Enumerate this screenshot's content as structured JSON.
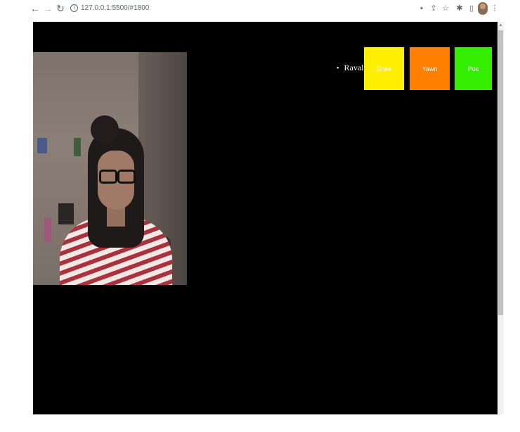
{
  "browser": {
    "url": "127.0.0.1:5500/#1800",
    "icons": [
      "back-icon",
      "forward-icon",
      "reload-icon",
      "info-icon",
      "screen-cast-icon",
      "share-icon",
      "star-icon",
      "extensions-icon",
      "sidebar-icon",
      "menu-icon"
    ]
  },
  "page": {
    "users": [
      "Ravali"
    ],
    "buttons": {
      "draw": {
        "label": "Draw",
        "color": "#ffee00"
      },
      "yawn": {
        "label": "Yawn",
        "color": "#ff7f00"
      },
      "pos": {
        "label": "Pos",
        "color": "#33ee00"
      }
    },
    "background": "#000000"
  }
}
